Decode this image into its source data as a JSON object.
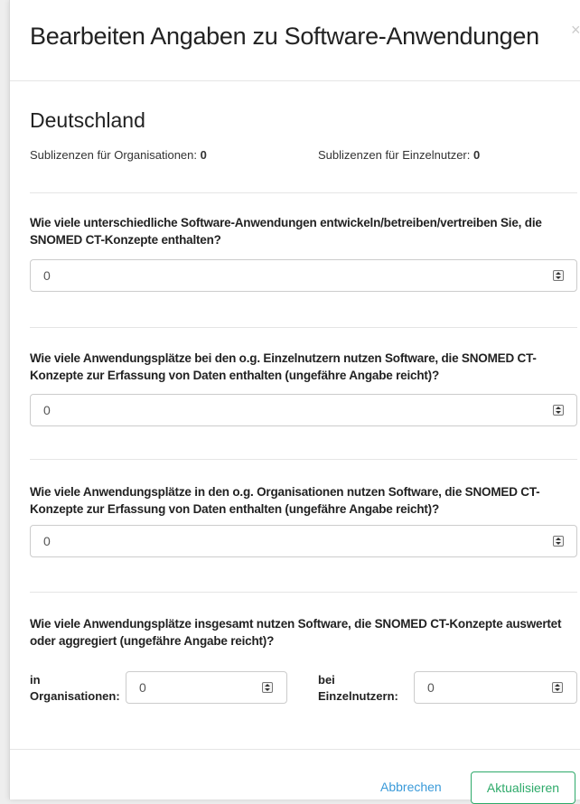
{
  "modal": {
    "title": "Bearbeiten Angaben zu Software-Anwendungen",
    "close_symbol": "×"
  },
  "country": "Deutschland",
  "sublicenses": {
    "organisations_label": "Sublizenzen für Organisationen:",
    "organisations_value": "0",
    "individuals_label": "Sublizenzen für Einzelnutzer:",
    "individuals_value": "0"
  },
  "questions": [
    {
      "text": "Wie viele unterschiedliche Software-Anwendungen entwickeln/betreiben/vertreiben Sie, die SNOMED CT-Konzepte enthalten?",
      "value": "0"
    },
    {
      "text": "Wie viele Anwendungsplätze bei den o.g. Einzelnutzern nutzen Software, die SNOMED CT-Konzepte zur Erfassung von Daten enthalten (ungefähre Angabe reicht)?",
      "value": "0"
    },
    {
      "text": "Wie viele Anwendungsplätze in den o.g. Organisationen nutzen Software, die SNOMED CT-Konzepte zur Erfassung von Daten enthalten (ungefähre Angabe reicht)?",
      "value": "0"
    },
    {
      "text": "Wie viele Anwendungsplätze insgesamt nutzen Software, die SNOMED CT-Konzepte auswertet oder aggregiert (ungefähre Angabe reicht)?",
      "org_label": "in Organisationen:",
      "org_value": "0",
      "ind_label": "bei Einzelnutzern:",
      "ind_value": "0"
    }
  ],
  "footer": {
    "cancel_label": "Abbrechen",
    "update_label": "Aktualisieren"
  },
  "colors": {
    "accent_link": "#3a9ad9",
    "accent_button": "#2eaa6a"
  },
  "icons": [
    "close-icon",
    "number-spinner-icon"
  ]
}
